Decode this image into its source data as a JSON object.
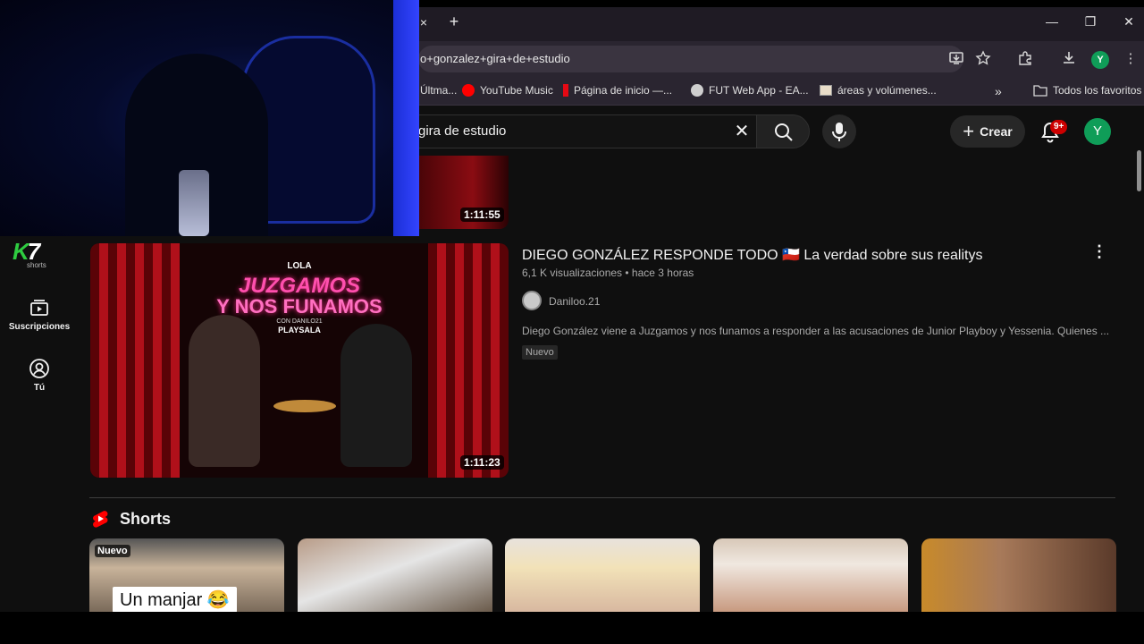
{
  "browser": {
    "tab_close": "×",
    "new_tab": "+",
    "window_controls": {
      "minimize": "—",
      "restore": "❐",
      "close": "✕"
    },
    "address": "o+gonzalez+gira+de+estudio",
    "profile_initial": "Y",
    "bookmarks": [
      {
        "label": "Últma...",
        "icon": "bookmark-icon"
      },
      {
        "label": "YouTube Music",
        "icon": "youtube-music-icon",
        "color": "#ff0000"
      },
      {
        "label": "Página de inicio —...",
        "icon": "netflix-icon",
        "color": "#e50914"
      },
      {
        "label": "FUT Web App - EA...",
        "icon": "globe-icon"
      },
      {
        "label": "áreas y volúmenes...",
        "icon": "page-icon"
      }
    ],
    "bookmarks_overflow": "»",
    "all_bookmarks": "Todos los favoritos"
  },
  "youtube": {
    "search_value": "gira de estudio",
    "create_label": "Crear",
    "notifications_count": "9+",
    "avatar_initial": "Y",
    "accent": "#ff0000"
  },
  "overlay": {
    "logo_k": "K",
    "logo_7": "7",
    "logo_sub": "shorts"
  },
  "sidebar": {
    "items": [
      {
        "label": "Suscripciones",
        "icon": "subscriptions-icon"
      },
      {
        "label": "Tú",
        "icon": "you-icon"
      }
    ]
  },
  "previous_video": {
    "duration": "1:11:55"
  },
  "video": {
    "title": "DIEGO GONZÁLEZ RESPONDE TODO 🇨🇱 La verdad sobre sus realitys",
    "meta": "6,1 K visualizaciones • hace 3 horas",
    "channel": "Daniloo.21",
    "description": "Diego González viene a Juzgamos y nos funamos a responder a las acusaciones de Junior Playboy y Yessenia. Quienes ...",
    "badge": "Nuevo",
    "duration": "1:11:23",
    "thumb_text": {
      "top": "LOLA",
      "line1": "JUZGAMOS",
      "line2": "Y NOS FUNAMOS",
      "sub": "CON DANILO21",
      "brand": "PLAYSALA"
    }
  },
  "shorts": {
    "title": "Shorts",
    "first_badge": "Nuevo",
    "first_caption": "Un manjar 😂"
  }
}
